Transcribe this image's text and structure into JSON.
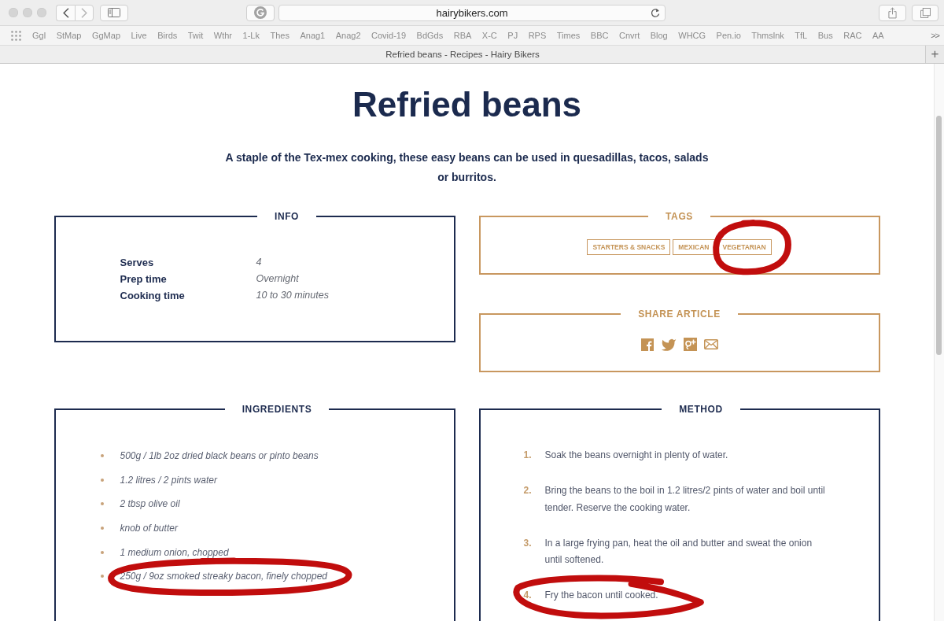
{
  "browser": {
    "back": {
      "disabled": false
    },
    "forward": {
      "disabled": true
    },
    "url": "hairybikers.com",
    "bookmarks": [
      "Ggl",
      "StMap",
      "GgMap",
      "Live",
      "Birds",
      "Twit",
      "Wthr",
      "1-Lk",
      "Thes",
      "Anag1",
      "Anag2",
      "Covid-19",
      "BdGds",
      "RBA",
      "X-C",
      "PJ",
      "RPS",
      "Times",
      "BBC",
      "Cnvrt",
      "Blog",
      "WHCG",
      "Pen.io",
      "Thmslnk",
      "TfL",
      "Bus",
      "RAC",
      "AA"
    ],
    "bookmarks_overflow": ">>",
    "tab_title": "Refried beans - Recipes - Hairy Bikers",
    "new_tab": "+"
  },
  "recipe": {
    "title": "Refried beans",
    "intro": "A staple of the Tex-mex cooking, these easy beans can be used in quesadillas, tacos, salads or burritos.",
    "info": {
      "heading": "INFO",
      "rows": [
        {
          "label": "Serves",
          "value": "4"
        },
        {
          "label": "Prep time",
          "value": "Overnight"
        },
        {
          "label": "Cooking time",
          "value": "10 to 30 minutes"
        }
      ]
    },
    "tags": {
      "heading": "TAGS",
      "items": [
        {
          "label": "STARTERS & SNACKS",
          "circled": false
        },
        {
          "label": "MEXICAN",
          "circled": false
        },
        {
          "label": "VEGETARIAN",
          "circled": true
        }
      ]
    },
    "share": {
      "heading": "SHARE ARTICLE"
    },
    "ingredients": {
      "heading": "INGREDIENTS",
      "items": [
        {
          "text": "500g / 1lb 2oz dried black beans or pinto beans",
          "circled": false
        },
        {
          "text": "1.2 litres / 2 pints water",
          "circled": false
        },
        {
          "text": "2 tbsp olive oil",
          "circled": false
        },
        {
          "text": "knob of butter",
          "circled": false
        },
        {
          "text": "1 medium onion, chopped",
          "circled": false
        },
        {
          "text": "250g / 9oz smoked streaky bacon, finely chopped",
          "circled": true
        }
      ]
    },
    "method": {
      "heading": "METHOD",
      "steps": [
        {
          "number": "1.",
          "text": "Soak the beans overnight in plenty of water.",
          "circled": false
        },
        {
          "number": "2.",
          "text": "Bring the beans to the boil in 1.2 litres/2 pints of water and boil until tender. Reserve the cooking water.",
          "circled": false
        },
        {
          "number": "3.",
          "text": "In a large frying pan, heat the oil and butter and sweat the onion until softened.",
          "circled": false
        },
        {
          "number": "4.",
          "text": "Fry the bacon until cooked.",
          "circled": true
        }
      ]
    }
  }
}
